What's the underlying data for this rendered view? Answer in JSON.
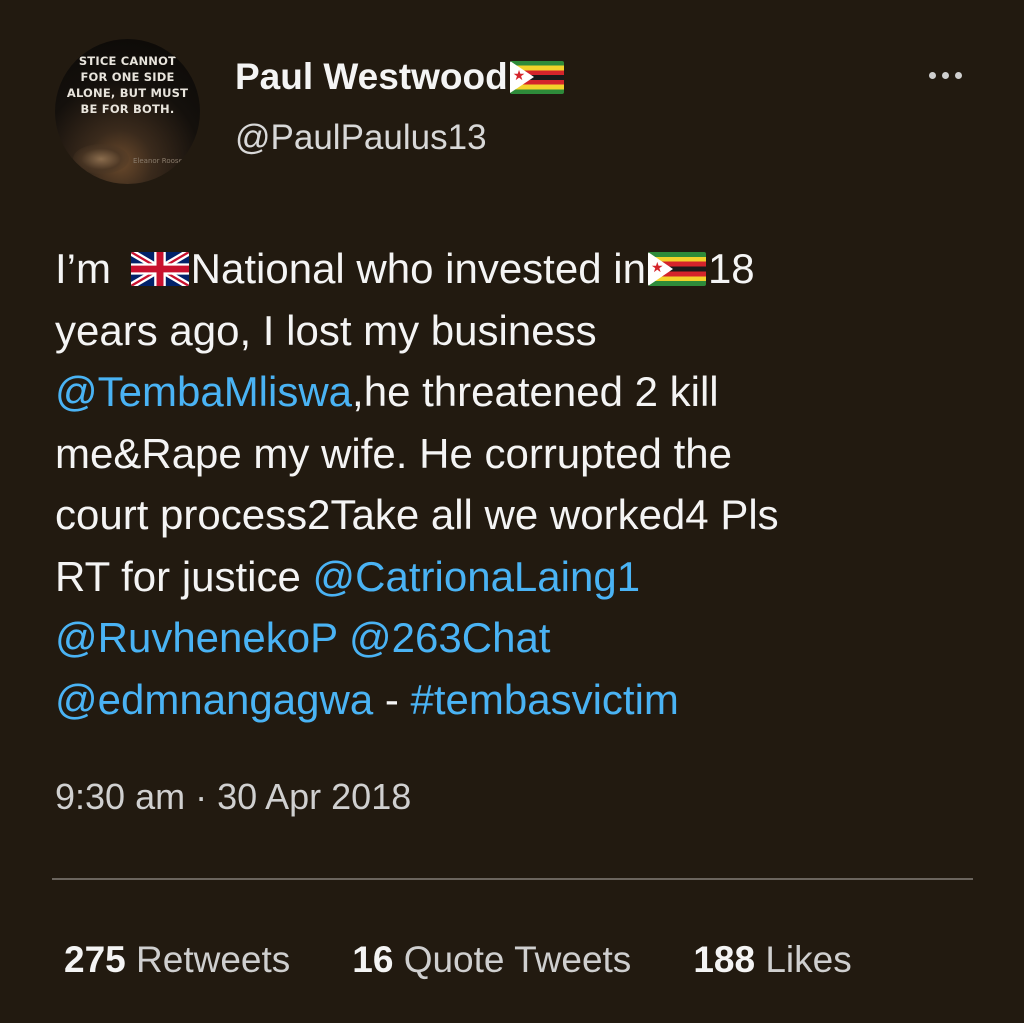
{
  "author": {
    "display_name": "Paul Westwood",
    "handle": "@PaulPaulus13",
    "name_flag": "zimbabwe-flag",
    "avatar": {
      "quote_lines": [
        "STICE CANNOT",
        "FOR ONE SIDE",
        "ALONE, BUT MUST",
        "BE FOR BOTH."
      ],
      "author_text": "Eleanor Roosevelt"
    }
  },
  "menu": {
    "icon": "more-horizontal-icon"
  },
  "tweet": {
    "lines": [
      [
        "I’m ",
        "{uk-flag}",
        "National who invested in",
        "{zw-flag}",
        "18"
      ],
      "years ago, I lost my business",
      [
        "@TembaMliswa",
        ",he threatened 2 kill"
      ],
      "me&Rape my wife. He corrupted the",
      "court process2Take all we worked4 Pls",
      [
        "RT for justice ",
        "@CatrionaLaing1"
      ],
      [
        "@RuvhenekoP",
        " ",
        "@263Chat"
      ],
      [
        "@edmnangagwa",
        " - ",
        "#tembasvictim"
      ]
    ],
    "segments": {
      "l1_a": "I’m ",
      "l1_b": "National who invested in",
      "l1_c": "18",
      "l2": "years ago, I lost my business",
      "l3_mention": "@TembaMliswa",
      "l3_rest": ",he threatened 2 kill",
      "l4": "me&Rape my wife. He corrupted the",
      "l5": "court process2Take all we worked4 Pls",
      "l6_a": "RT for justice ",
      "l6_mention": "@CatrionaLaing1",
      "l7_mention1": "@RuvhenekoP",
      "l7_mention2": "@263Chat",
      "l8_mention": "@edmnangagwa",
      "l8_sep": " - ",
      "l8_hashtag": "#tembasvictim"
    },
    "timestamp": "9:30 am · 30 Apr 2018"
  },
  "stats": {
    "retweets_count": "275",
    "retweets_label": "Retweets",
    "quotes_count": "16",
    "quotes_label": "Quote Tweets",
    "likes_count": "188",
    "likes_label": "Likes"
  },
  "colors": {
    "background": "#221a10",
    "link": "#4ab3f4",
    "text": "#f4f4f4",
    "muted": "#cfcfcf"
  }
}
